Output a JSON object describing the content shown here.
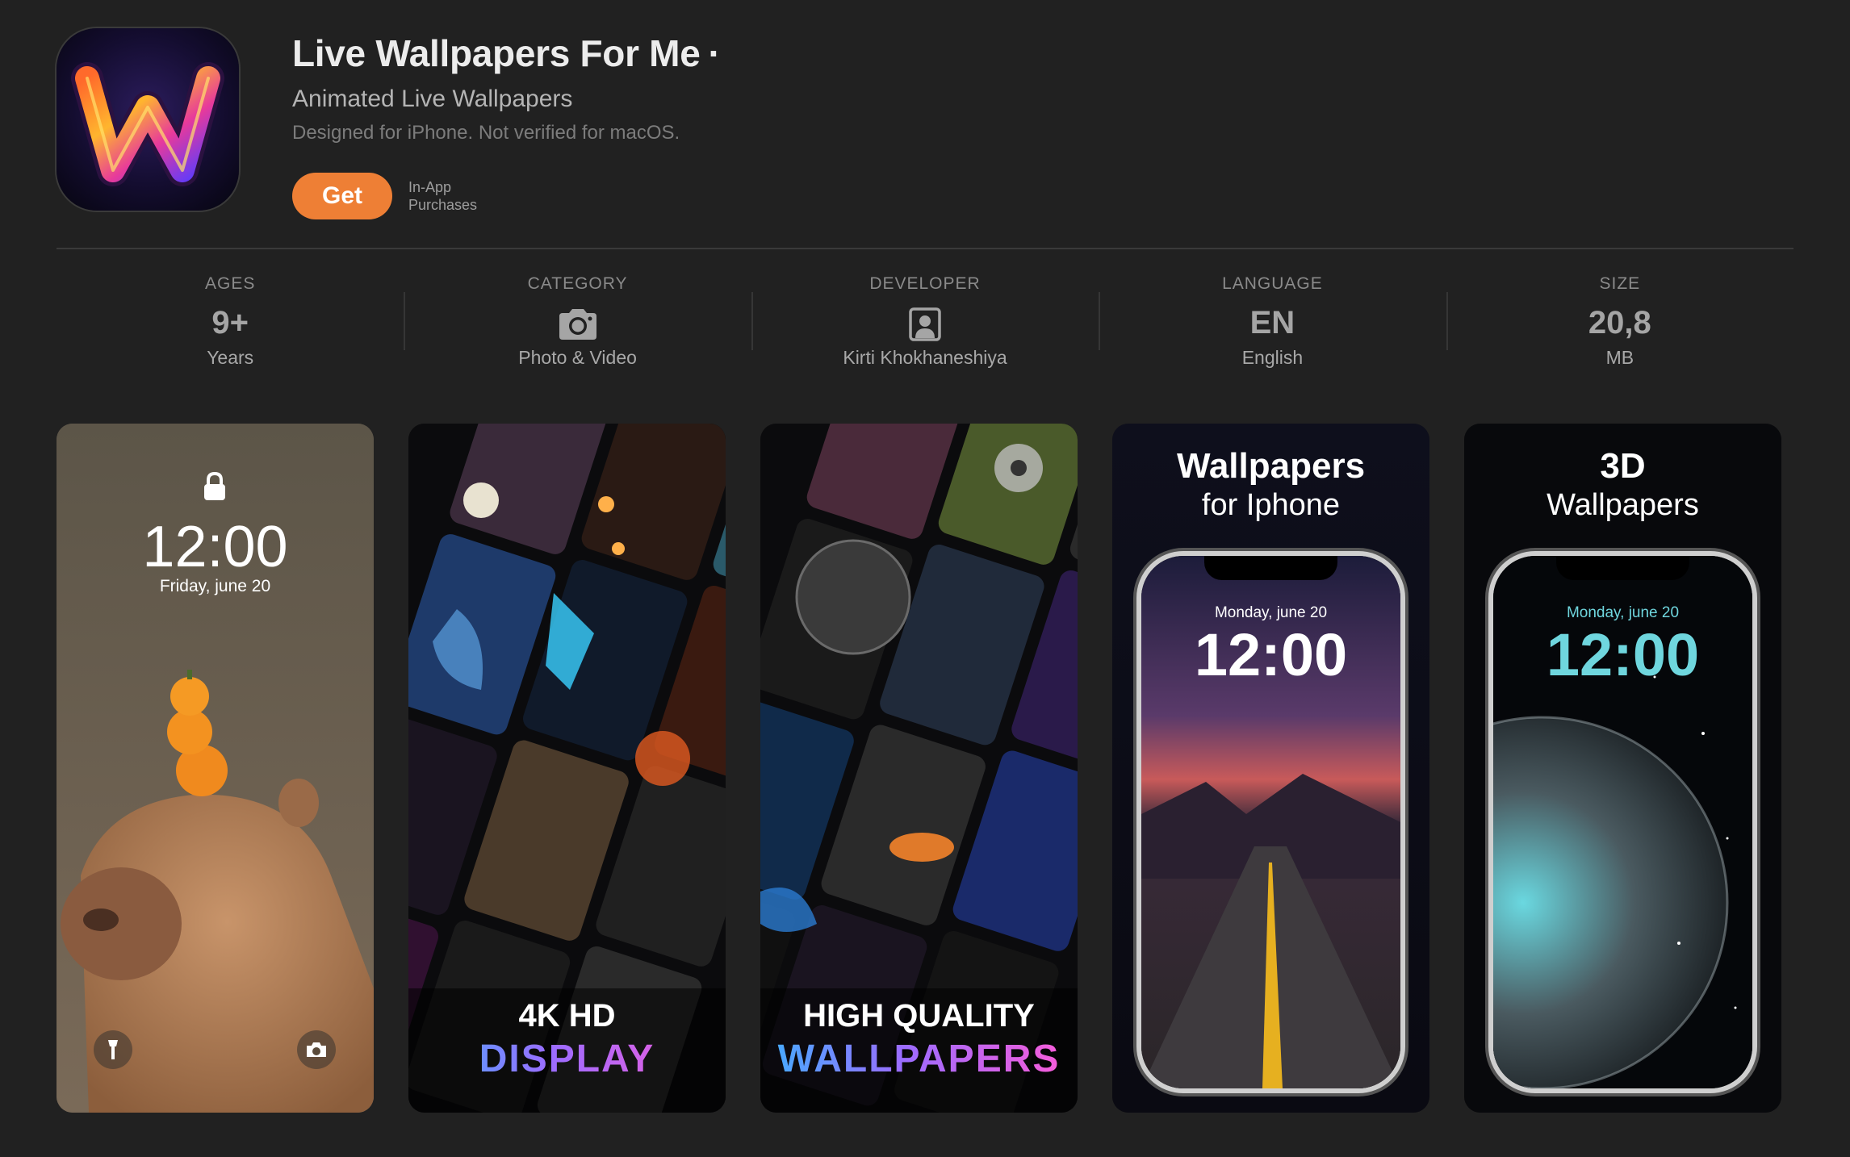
{
  "app": {
    "title": "Live Wallpapers For Me",
    "title_suffix": "·",
    "subtitle": "Animated Live Wallpapers",
    "note": "Designed for iPhone. Not verified for macOS.",
    "get_label": "Get",
    "iap_line1": "In-App",
    "iap_line2": "Purchases",
    "accent_color": "#ee7f35"
  },
  "info": [
    {
      "label": "AGES",
      "value": "9+",
      "sub": "Years"
    },
    {
      "label": "CATEGORY",
      "icon": "camera-icon",
      "sub": "Photo & Video"
    },
    {
      "label": "DEVELOPER",
      "icon": "person-icon",
      "sub": "Kirti Khokhaneshiya"
    },
    {
      "label": "LANGUAGE",
      "value": "EN",
      "sub": "English"
    },
    {
      "label": "SIZE",
      "value": "20,8",
      "sub": "MB"
    }
  ],
  "screenshots": {
    "s1": {
      "time": "12:00",
      "date": "Friday, june 20"
    },
    "s2": {
      "line1": "4K HD",
      "line2": "DISPLAY"
    },
    "s3": {
      "line1": "HIGH QUALITY",
      "line2": "WALLPAPERS"
    },
    "s4": {
      "title1": "Wallpapers",
      "title2": "for Iphone",
      "date": "Monday, june 20",
      "time": "12:00"
    },
    "s5": {
      "title1": "3D",
      "title2": "Wallpapers",
      "date": "Monday, june 20",
      "time": "12:00"
    }
  }
}
